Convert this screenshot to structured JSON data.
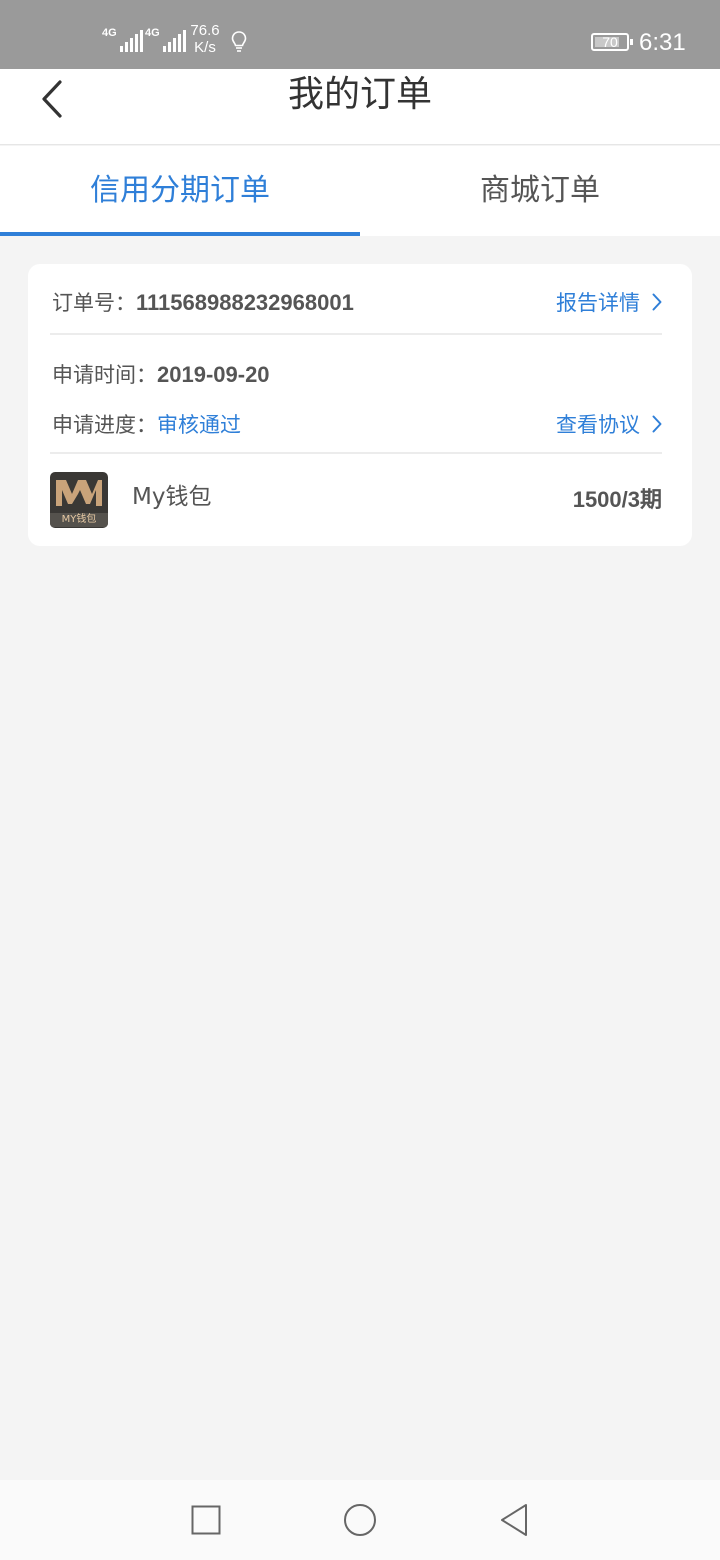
{
  "status_bar": {
    "sim1_network": "4G",
    "sim2_network": "4G",
    "net_speed_value": "76.6",
    "net_speed_unit": "K/s",
    "battery_level": "70",
    "time": "6:31"
  },
  "header": {
    "title": "我的订单",
    "back_icon": "chevron-left-icon"
  },
  "tabs": [
    {
      "label": "信用分期订单",
      "active": true
    },
    {
      "label": "商城订单",
      "active": false
    }
  ],
  "order": {
    "number_label": "订单号：",
    "number_value": "111568988232968001",
    "report_link": "报告详情",
    "apply_time_label": "申请时间：",
    "apply_time_value": "2019-09-20",
    "progress_label": "申请进度：",
    "progress_value": "审核通过",
    "agreement_link": "查看协议",
    "product": {
      "logo_text": "MY钱包",
      "name": "My钱包",
      "amount": "1500/3期"
    }
  },
  "colors": {
    "accent": "#2f7fd8",
    "status_bar": "#9a9a9a",
    "background": "#f4f4f4",
    "logo_gold": "#c9a37a"
  },
  "system_nav": {
    "recents_icon": "square-icon",
    "home_icon": "circle-icon",
    "back_icon": "triangle-back-icon"
  }
}
